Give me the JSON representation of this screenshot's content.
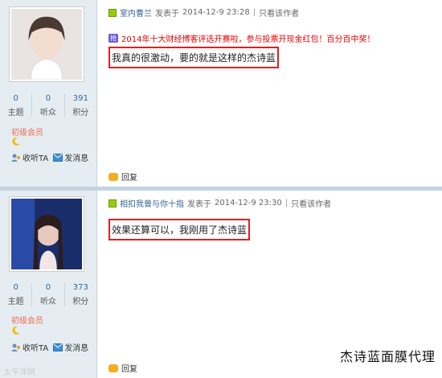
{
  "posts": [
    {
      "username": "室内曹兰",
      "posted_label": "发表于",
      "date": "2014-12-9 23:28",
      "view_author": "只看该作者",
      "stats": [
        {
          "value": "0",
          "label": "主题"
        },
        {
          "value": "0",
          "label": "听众"
        },
        {
          "value": "391",
          "label": "积分"
        }
      ],
      "rank": "初级会员",
      "follow": "收听TA",
      "message_btn": "发消息",
      "promo_badge": "抢",
      "promo": "2014年十大财经博客评选开赛啦，参与投票开现金红包！百分百中奖！",
      "message": "我真的很激动，要的就是这样的杰诗蓝",
      "reply": "回复"
    },
    {
      "username": "相扣我曾与你十指",
      "posted_label": "发表于",
      "date": "2014-12-9 23:30",
      "view_author": "只看该作者",
      "stats": [
        {
          "value": "0",
          "label": "主题"
        },
        {
          "value": "0",
          "label": "听众"
        },
        {
          "value": "373",
          "label": "积分"
        }
      ],
      "rank": "初级会员",
      "follow": "收听TA",
      "message_btn": "发消息",
      "message": "效果还算可以，我刚用了杰诗蓝",
      "reply": "回复"
    }
  ],
  "watermark_left": "太平洋网",
  "watermark_right": "杰诗蓝面膜代理",
  "colors": {
    "sidebar": "#e5edf2",
    "link": "#336699",
    "rank": "#f26c4f",
    "highlight_border": "#e02020",
    "promo": "#e60000"
  }
}
